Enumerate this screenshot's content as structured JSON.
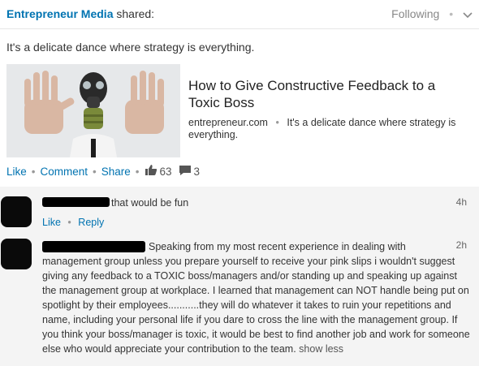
{
  "header": {
    "author": "Entrepreneur Media",
    "action": "shared:",
    "follow_label": "Following"
  },
  "post": {
    "text": "It's a delicate dance where strategy is everything."
  },
  "share_card": {
    "title": "How to Give Constructive Feedback to a Toxic Boss",
    "domain": "entrepreneur.com",
    "description": "It's a delicate dance where strategy is everything."
  },
  "actions": {
    "like_label": "Like",
    "comment_label": "Comment",
    "share_label": "Share",
    "likes_count": "63",
    "comments_count": "3"
  },
  "comments": [
    {
      "text": "that would be fun",
      "time": "4h",
      "like_label": "Like",
      "reply_label": "Reply"
    },
    {
      "first_line": "Speaking from my most recent experience in dealing with",
      "body": "management group unless you prepare yourself to receive your pink slips i wouldn't suggest giving any feedback to a TOXIC boss/managers and/or standing up and speaking up against the management group at workplace. I learned that management can NOT handle being put on spotlight by their employees...........they will do whatever it takes to ruin your repetitions and name, including your personal life if you dare to cross the line with the management group. If you think your boss/manager is toxic, it would be best to find another job and work for someone else who would appreciate your contribution to the team.",
      "show_less_label": "show less",
      "time": "2h"
    }
  ],
  "icons": {
    "dropdown": "chevron-down-icon",
    "likes": "thumbs-up-icon",
    "comments": "comment-bubble-icon",
    "thumbnail": "gas-mask-man-image"
  },
  "colors": {
    "link": "#0073b1",
    "comment_bg": "#f4f4f4"
  }
}
